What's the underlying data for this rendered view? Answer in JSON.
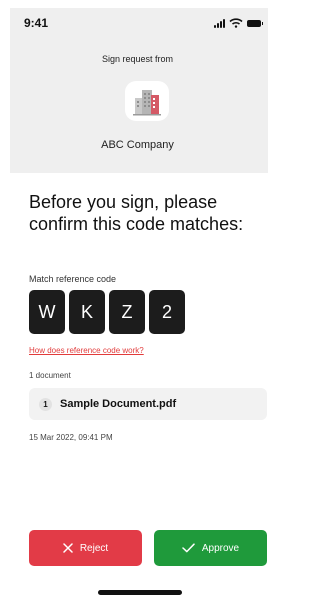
{
  "status_bar": {
    "time": "9:41",
    "icons": [
      "signal-icon",
      "wifi-icon",
      "battery-icon"
    ]
  },
  "header": {
    "title": "Sign request from",
    "company": "ABC Company",
    "logo_icon": "company-building-icon"
  },
  "main": {
    "heading": "Before you sign, please confirm this code matches:",
    "code_label": "Match reference code",
    "code": [
      "W",
      "K",
      "Z",
      "2"
    ],
    "help_link": "How does reference code work?",
    "document_count": "1 document",
    "documents": [
      {
        "index": "1",
        "name": "Sample Document.pdf"
      }
    ],
    "timestamp": "15 Mar 2022, 09:41 PM"
  },
  "actions": {
    "reject_label": "Reject",
    "reject_icon": "close-icon",
    "approve_label": "Approve",
    "approve_icon": "check-icon"
  },
  "colors": {
    "reject": "#e23b47",
    "approve": "#1f9a3b",
    "link": "#e23b3b",
    "code_bg": "#1c1c1c"
  }
}
